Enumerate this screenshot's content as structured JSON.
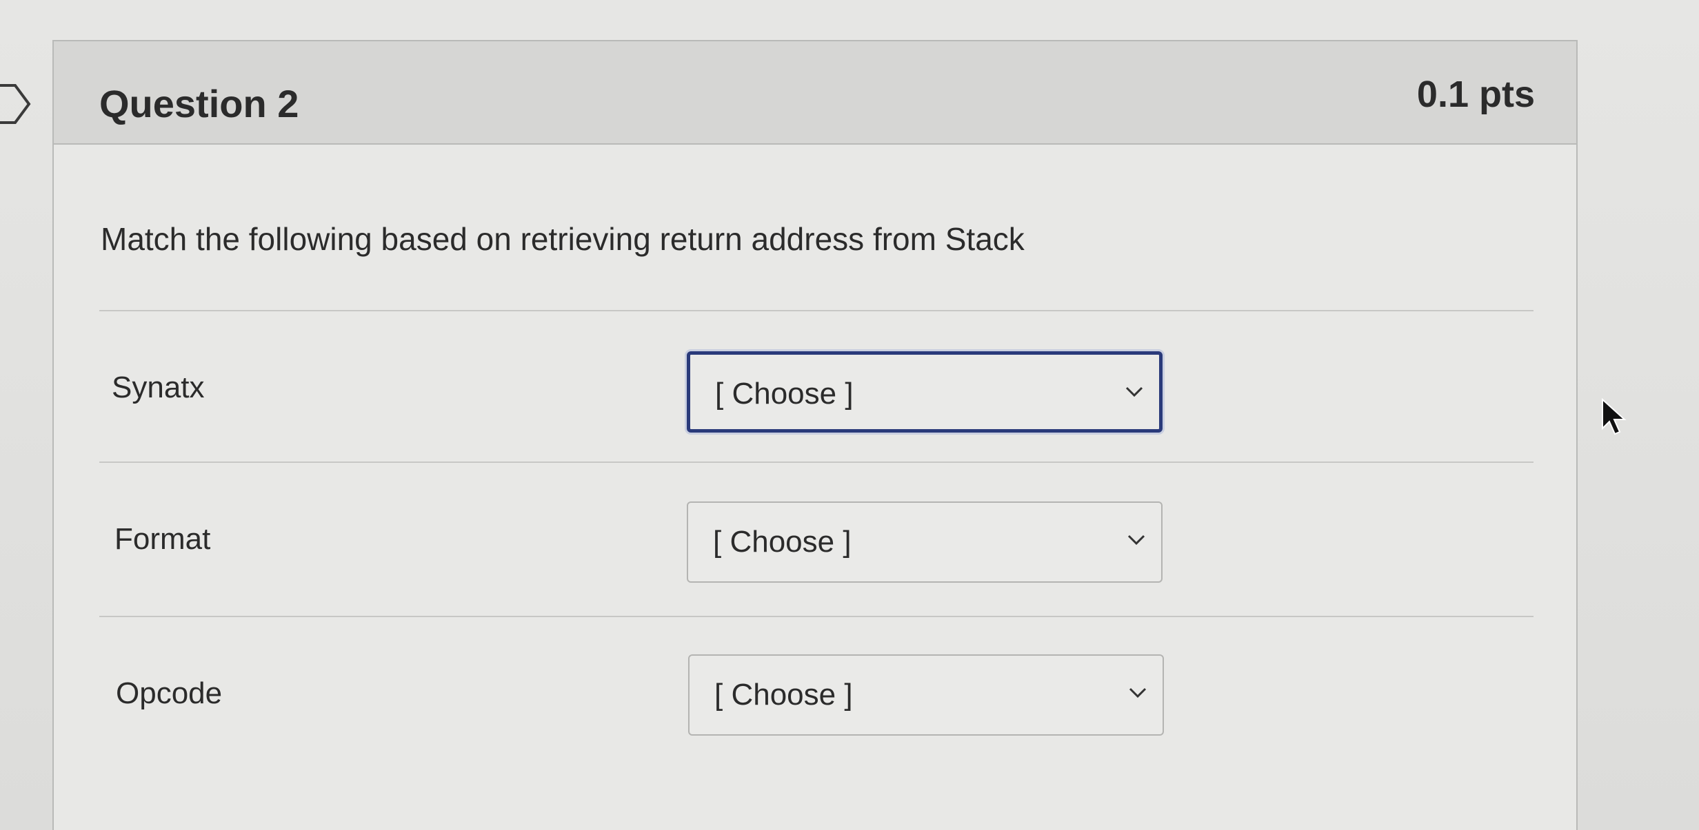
{
  "question": {
    "title": "Question 2",
    "points": "0.1 pts",
    "prompt": "Match the following based on retrieving return address from Stack"
  },
  "matches": [
    {
      "label": "Synatx",
      "selected": "[ Choose ]",
      "focused": true
    },
    {
      "label": "Format",
      "selected": "[ Choose ]",
      "focused": false
    },
    {
      "label": "Opcode",
      "selected": "[ Choose ]",
      "focused": false
    }
  ],
  "icons": {
    "flag": "flag-outline-icon",
    "chevron": "chevron-down-icon",
    "cursor": "mouse-pointer-icon"
  },
  "colors": {
    "focus_border": "#2a3a7a",
    "header_bg": "#d6d6d4"
  }
}
